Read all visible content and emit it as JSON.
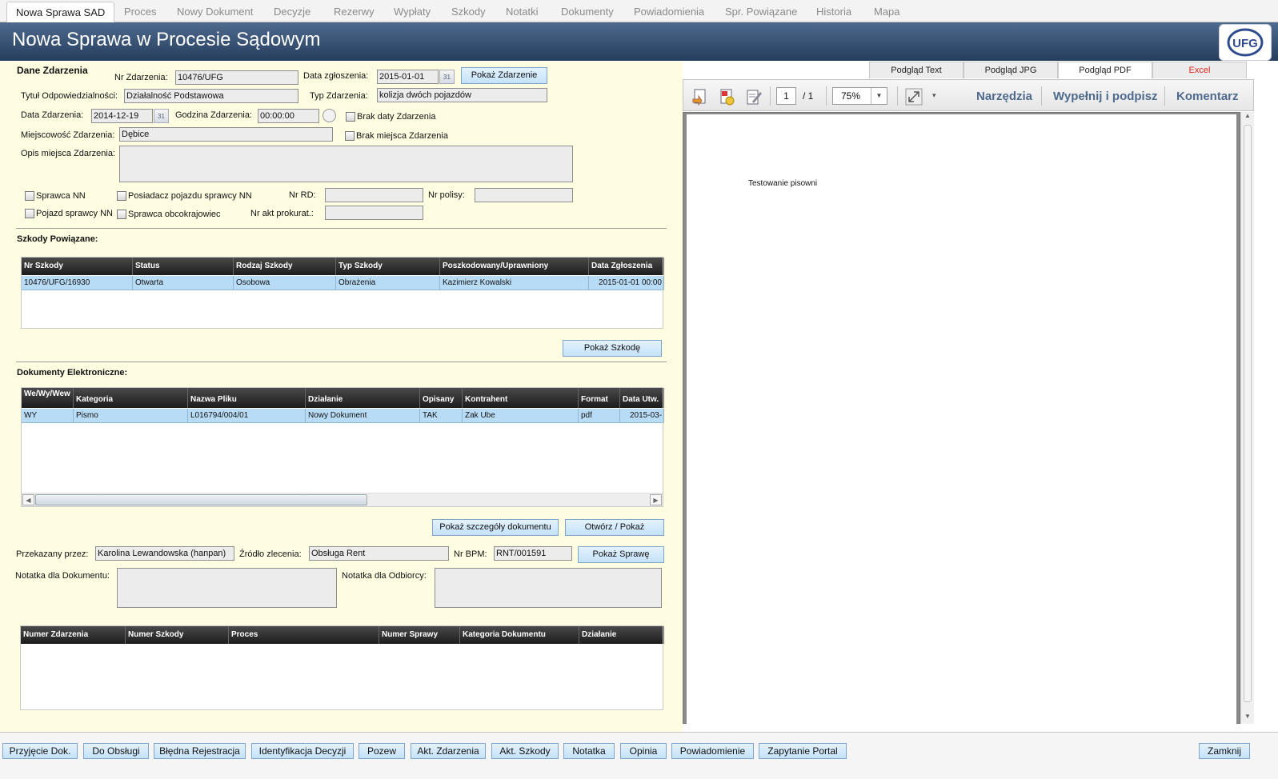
{
  "top_tabs": [
    "Nowa Sprawa SAD",
    "Proces",
    "Nowy Dokument",
    "Decyzje",
    "Rezerwy",
    "Wypłaty",
    "Szkody",
    "Notatki",
    "Dokumenty",
    "Powiadomienia",
    "Spr. Powiązane",
    "Historia",
    "Mapa"
  ],
  "header": {
    "title": "Nowa Sprawa w Procesie Sądowym",
    "logo_text": "UFG"
  },
  "incident": {
    "section_title": "Dane Zdarzenia",
    "nr_label": "Nr Zdarzenia:",
    "nr_value": "10476/UFG",
    "report_date_label": "Data zgłoszenia:",
    "report_date_value": "2015-01-01",
    "show_event_button": "Pokaż Zdarzenie",
    "liability_label": "Tytuł Odpowiedzialności:",
    "liability_value": "Działalność Podstawowa",
    "type_label": "Typ Zdarzenia:",
    "type_value": "kolizja dwóch pojazdów",
    "date_label": "Data Zdarzenia:",
    "date_value": "2014-12-19",
    "time_label": "Godzina Zdarzenia:",
    "time_value": "00:00:00",
    "no_date_label": "Brak daty Zdarzenia",
    "place_label": "Miejscowość Zdarzenia:",
    "place_value": "Dębice",
    "no_place_label": "Brak miejsca Zdarzenia",
    "desc_label": "Opis miejsca Zdarzenia:",
    "desc_value": "",
    "checks": [
      "Sprawca NN",
      "Posiadacz pojazdu sprawcy NN",
      "Pojazd sprawcy NN",
      "Sprawca obcokrajowiec"
    ],
    "nr_rd_label": "Nr RD:",
    "nr_rd_value": "",
    "policy_label": "Nr polisy:",
    "policy_value": "",
    "prosecutor_label": "Nr akt prokurat.:",
    "prosecutor_value": ""
  },
  "claims": {
    "section_title": "Szkody Powiązane:",
    "columns": [
      "Nr Szkody",
      "Status",
      "Rodzaj Szkody",
      "Typ Szkody",
      "Poszkodowany/Uprawniony",
      "Data Zgłoszenia"
    ],
    "rows": [
      [
        "10476/UFG/16930",
        "Otwarta",
        "Osobowa",
        "Obrażenia",
        "Kazimierz Kowalski",
        "2015-01-01 00:00"
      ]
    ],
    "show_button": "Pokaż Szkodę"
  },
  "documents": {
    "section_title": "Dokumenty Elektroniczne:",
    "columns": [
      "We/Wy/Wew",
      "Kategoria",
      "Nazwa Pliku",
      "Działanie",
      "Opisany",
      "Kontrahent",
      "Format",
      "Data Utw."
    ],
    "rows": [
      [
        "WY",
        "Pismo",
        "L016794/004/01",
        "Nowy Dokument",
        "TAK",
        "Zak Ube",
        "pdf",
        "2015-03-"
      ]
    ],
    "details_button": "Pokaż szczegóły dokumentu",
    "open_button": "Otwórz / Pokaż"
  },
  "transfer": {
    "by_label": "Przekazany przez:",
    "by_value": "Karolina Lewandowska (hanpan)",
    "source_label": "Źródło zlecenia:",
    "source_value": "Obsługa Rent",
    "bpm_label": "Nr BPM:",
    "bpm_value": "RNT/001591",
    "show_case_button": "Pokaż Sprawę",
    "doc_note_label": "Notatka dla Dokumentu:",
    "doc_note_value": "",
    "recipient_note_label": "Notatka dla Odbiorcy:",
    "recipient_note_value": ""
  },
  "links": {
    "columns": [
      "Numer Zdarzenia",
      "Numer Szkody",
      "Proces",
      "Numer Sprawy",
      "Kategoria Dokumentu",
      "Działanie"
    ]
  },
  "preview": {
    "tabs": [
      "Podgląd Text",
      "Podgląd JPG",
      "Podgląd PDF",
      "Excel"
    ],
    "excel_color": "#e0261b",
    "page_current": "1",
    "page_total": "/ 1",
    "zoom": "75%",
    "tools": [
      "Narzędzia",
      "Wypełnij i podpisz",
      "Komentarz"
    ],
    "document_text": "Testowanie pisowni"
  },
  "bottom_buttons": [
    "Przyjęcie Dok.",
    "Do Obsługi",
    "Błędna Rejestracja",
    "Identyfikacja Decyzji",
    "Pozew",
    "Akt. Zdarzenia",
    "Akt. Szkody",
    "Notatka",
    "Opinia",
    "Powiadomienie",
    "Zapytanie Portal"
  ],
  "close_button": "Zamknij",
  "colors": {
    "header": "#2f4a6d",
    "form_bg": "#fefde2",
    "button": "#c4e2f8",
    "grid_header": "#2a2a2a",
    "selected_row": "#b9dcf6"
  }
}
